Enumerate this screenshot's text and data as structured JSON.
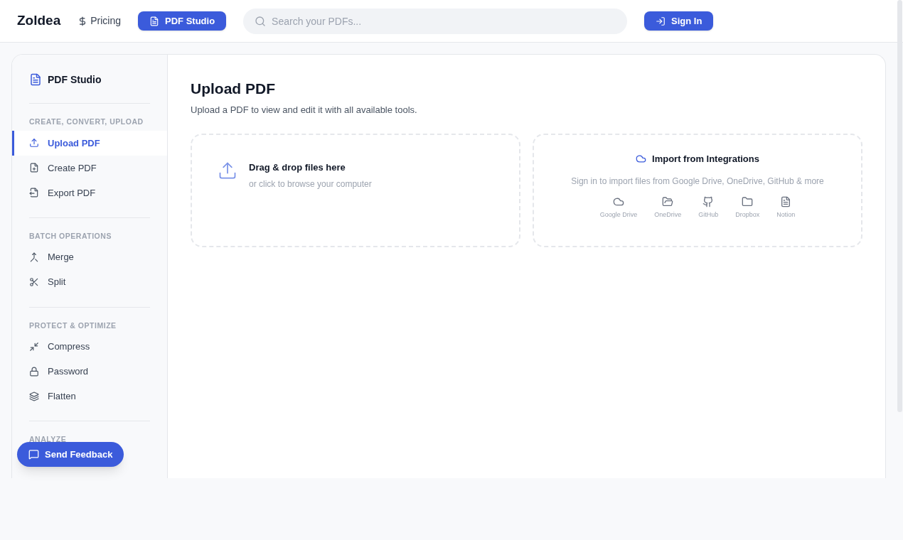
{
  "header": {
    "logo": "Zoldea",
    "nav": [
      {
        "label": "Pricing",
        "selected": false
      },
      {
        "label": "PDF Studio",
        "selected": true
      }
    ],
    "search": {
      "placeholder": "Search your PDFs..."
    },
    "sign_in": "Sign In"
  },
  "sidebar": {
    "title": "PDF Studio",
    "sections": [
      {
        "label": "CREATE, CONVERT, UPLOAD",
        "items": [
          {
            "label": "Upload PDF",
            "selected": true
          },
          {
            "label": "Create PDF",
            "selected": false
          },
          {
            "label": "Export PDF",
            "selected": false
          }
        ]
      },
      {
        "label": "BATCH OPERATIONS",
        "items": [
          {
            "label": "Merge",
            "selected": false
          },
          {
            "label": "Split",
            "selected": false
          }
        ]
      },
      {
        "label": "PROTECT & OPTIMIZE",
        "items": [
          {
            "label": "Compress",
            "selected": false
          },
          {
            "label": "Password",
            "selected": false
          },
          {
            "label": "Flatten",
            "selected": false
          }
        ]
      },
      {
        "label": "ANALYZE"
      }
    ]
  },
  "main": {
    "title": "Upload PDF",
    "subtitle": "Upload a PDF to view and edit it with all available tools.",
    "dropzone": {
      "title": "Drag & drop files here",
      "hint": "or click to browse your computer"
    },
    "integrations": {
      "title": "Import from Integrations",
      "hint": "Sign in to import files from Google Drive, OneDrive, GitHub & more",
      "items": [
        "Google Drive",
        "OneDrive",
        "GitHub",
        "Dropbox",
        "Notion"
      ]
    }
  },
  "feedback_button": "Send Feedback"
}
